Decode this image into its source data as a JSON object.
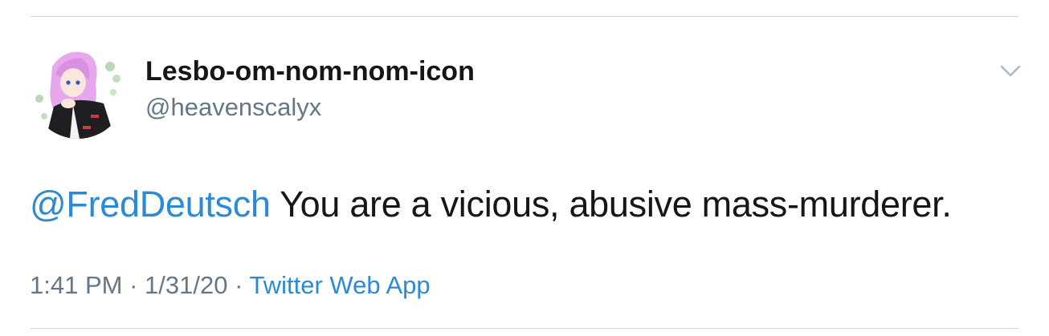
{
  "tweet": {
    "display_name": "Lesbo-om-nom-nom-icon",
    "handle": "@heavenscalyx",
    "mention": "@FredDeutsch",
    "text": "You are a vicious, abusive mass-murderer.",
    "time": "1:41 PM",
    "separator": "·",
    "date": "1/31/20",
    "source": "Twitter Web App"
  },
  "icons": {
    "menu": "chevron-down-icon",
    "avatar": "profile-avatar"
  },
  "colors": {
    "link": "#2b8ad6",
    "primary_text": "#14171a",
    "secondary_text": "#657786",
    "divider": "#d4d7da"
  }
}
